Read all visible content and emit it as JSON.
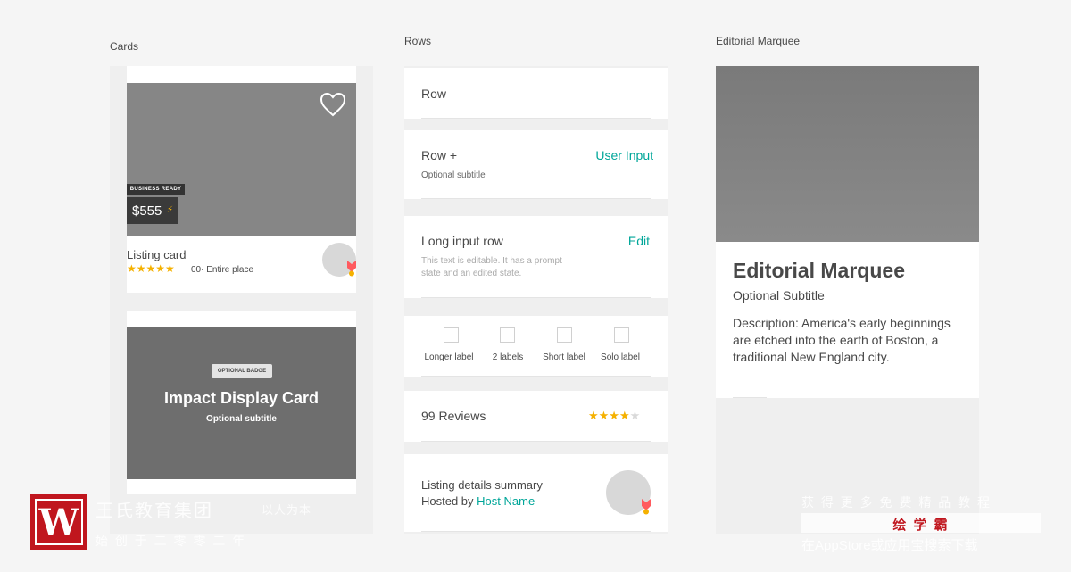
{
  "sections": {
    "cards": "Cards",
    "rows": "Rows",
    "editorial": "Editorial Marquee"
  },
  "listing_card": {
    "badge": "BUSINESS READY",
    "price": "$555",
    "bolt": "⚡",
    "title": "Listing card",
    "stars": "★★★★★",
    "reviews": "00",
    "separator": "·",
    "type": "Entire place"
  },
  "impact_card": {
    "badge": "OPTIONAL BADGE",
    "title": "Impact Display Card",
    "subtitle": "Optional subtitle"
  },
  "rows": {
    "row": "Row",
    "row_plus": "Row +",
    "row_plus_subtitle": "Optional subtitle",
    "row_plus_action": "User Input",
    "long_input_title": "Long input row",
    "long_input_action": "Edit",
    "long_input_text_1": "This text is editable. It has a prompt",
    "long_input_text_2": "state and an edited state.",
    "checkbox_labels": [
      "Longer label",
      "2 labels",
      "Short label",
      "Solo label"
    ],
    "reviews_label": "99 Reviews",
    "reviews_stars_on": "★★★★",
    "reviews_stars_off": "★",
    "summary_title": "Listing details summary",
    "summary_hosted": "Hosted by",
    "summary_host": "Host Name"
  },
  "editorial": {
    "title": "Editorial Marquee",
    "subtitle": "Optional Subtitle",
    "description": "Description: America's early beginnings are etched into the earth of Boston, a traditional New England city."
  },
  "watermark": {
    "logo_letter": "W",
    "brand": "王氏教育集团",
    "motto": "以人为本",
    "founded": "始 创 于 二 零 零 二 年",
    "promo_top": "获 得 更 多 免 费 精 品 教 程",
    "promo_app": "绘 学 霸",
    "promo_bottom": "在AppStore或应用宝搜索下载"
  },
  "colors": {
    "accent": "#00a699",
    "star": "#f5b100",
    "brand_red": "#c0161e"
  }
}
